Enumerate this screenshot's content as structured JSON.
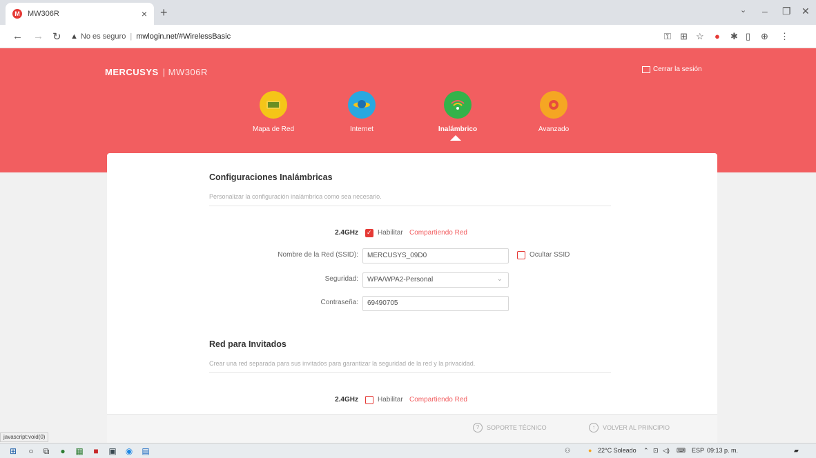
{
  "browser": {
    "tab_title": "MW306R",
    "favicon": "M",
    "close_tab": "×",
    "new_tab": "+",
    "win_minimize": "–",
    "win_restore": "❐",
    "win_close": "✕",
    "win_dropdown": "⌄",
    "security_text": "No es seguro",
    "url": "mwlogin.net/#WirelessBasic"
  },
  "header": {
    "brand": "MERCUSYS",
    "model": "| MW306R",
    "logout": "Cerrar la sesión",
    "nav": [
      {
        "label": "Mapa de Red",
        "icon": "network-map-icon",
        "color": "#f5c518"
      },
      {
        "label": "Internet",
        "icon": "planet-icon",
        "color": "#29a8e0"
      },
      {
        "label": "Inalámbrico",
        "icon": "wifi-icon",
        "color": "#34b24a"
      },
      {
        "label": "Avanzado",
        "icon": "gear-icon",
        "color": "#f5a623"
      }
    ]
  },
  "wireless": {
    "title": "Configuraciones Inalámbricas",
    "desc": "Personalizar la configuración inalámbrica como sea necesario.",
    "band_label": "2.4GHz",
    "enable_label": "Habilitar",
    "share_label": "Compartiendo Red",
    "ssid_label": "Nombre de la Red (SSID):",
    "ssid_value": "MERCUSYS_09D0",
    "hide_ssid_label": "Ocultar SSID",
    "security_label": "Seguridad:",
    "security_value": "WPA/WPA2-Personal",
    "password_label": "Contraseña:",
    "password_value": "69490705"
  },
  "guest": {
    "title": "Red para Invitados",
    "desc": "Crear una red separada para sus invitados para garantizar la seguridad de la red y la privacidad.",
    "band_label": "2.4GHz",
    "enable_label": "Habilitar",
    "share_label": "Compartiendo Red"
  },
  "footer": {
    "support": "SOPORTE TÉCNICO",
    "back_to_top": "VOLVER AL PRINCIPIO"
  },
  "statusbar": "javascript:void(0)",
  "taskbar": {
    "weather": "22°C Soleado",
    "lang": "ESP",
    "time": "09:13 p. m."
  }
}
